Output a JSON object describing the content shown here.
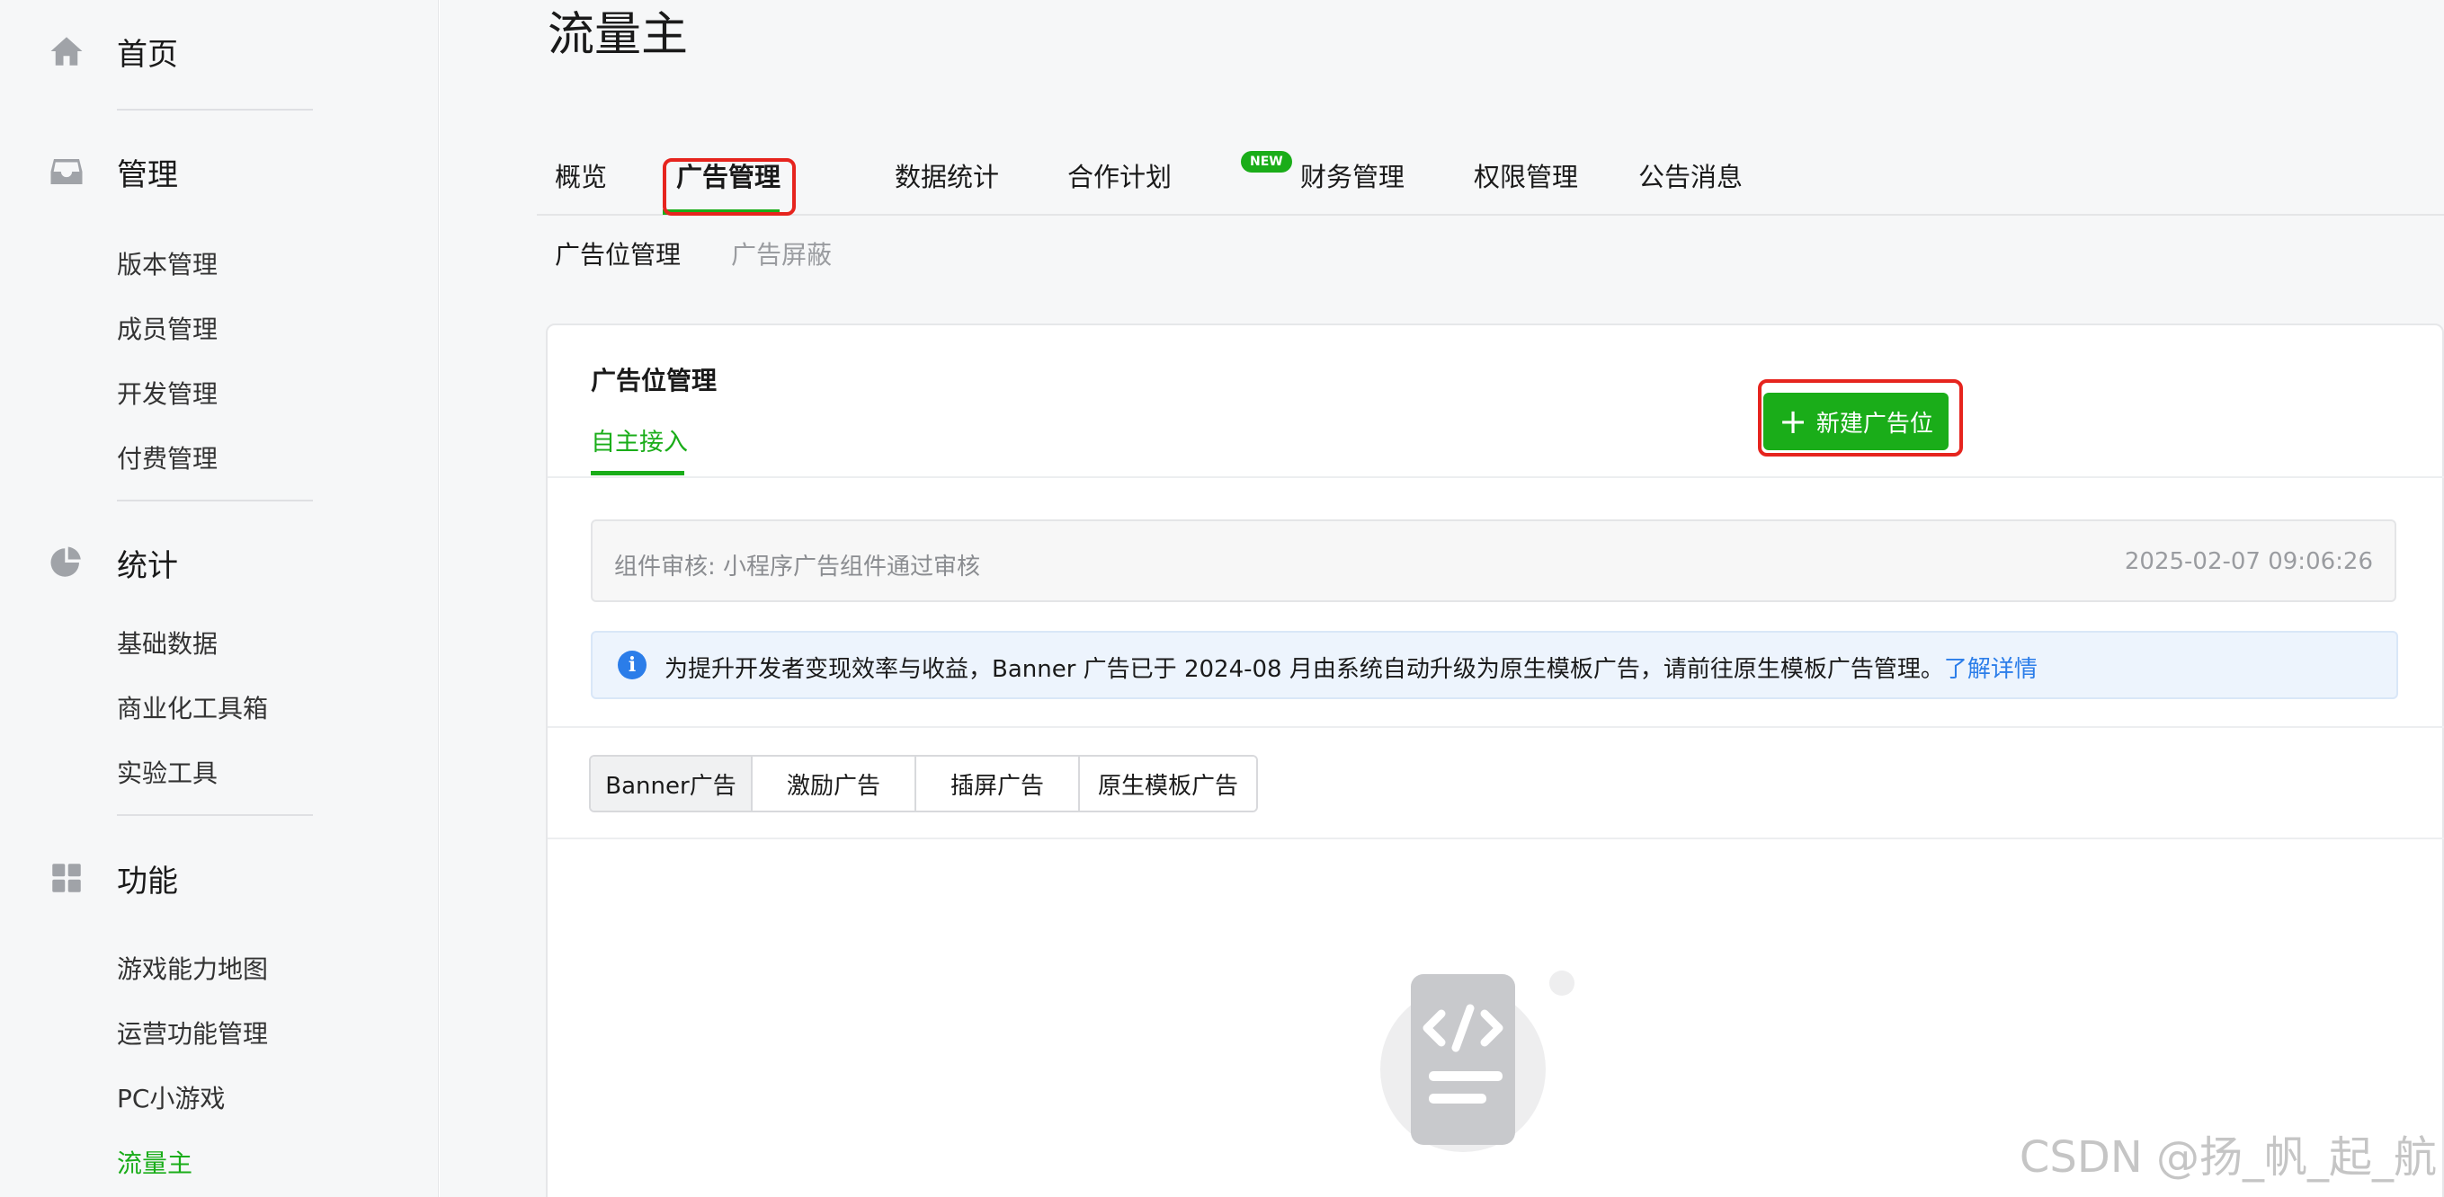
{
  "sidebar": {
    "home": {
      "icon": "home-icon",
      "label": "首页"
    },
    "manage": {
      "icon": "inbox-icon",
      "label": "管理",
      "items": [
        "版本管理",
        "成员管理",
        "开发管理",
        "付费管理"
      ]
    },
    "stats": {
      "icon": "pie-chart-icon",
      "label": "统计",
      "items": [
        "基础数据",
        "商业化工具箱",
        "实验工具"
      ]
    },
    "features": {
      "icon": "grid-icon",
      "label": "功能",
      "items": [
        "游戏能力地图",
        "运营功能管理",
        "PC小游戏",
        "流量主"
      ]
    }
  },
  "page": {
    "title": "流量主"
  },
  "tabs": {
    "items": [
      "概览",
      "广告管理",
      "数据统计",
      "合作计划",
      "财务管理",
      "权限管理",
      "公告消息"
    ],
    "new_badge": "NEW",
    "active": "广告管理"
  },
  "subtabs": {
    "items": [
      "广告位管理",
      "广告屏蔽"
    ]
  },
  "card": {
    "title": "广告位管理",
    "tab": "自主接入",
    "new_button": "新建广告位",
    "audit": {
      "text": "组件审核: 小程序广告组件通过审核",
      "time": "2025-02-07 09:06:26"
    },
    "notice": {
      "text": "为提升开发者变现效率与收益，Banner 广告已于 2024-08 月由系统自动升级为原生模板广告，请前往原生模板广告管理。",
      "link": "了解详情"
    },
    "ad_types": [
      "Banner广告",
      "激励广告",
      "插屏广告",
      "原生模板广告"
    ],
    "empty_icon": "code-document-icon"
  },
  "watermark": "CSDN @扬_帆_起_航",
  "colors": {
    "accent": "#1aad19",
    "highlight": "#e6241e",
    "link": "#2b7de9"
  }
}
